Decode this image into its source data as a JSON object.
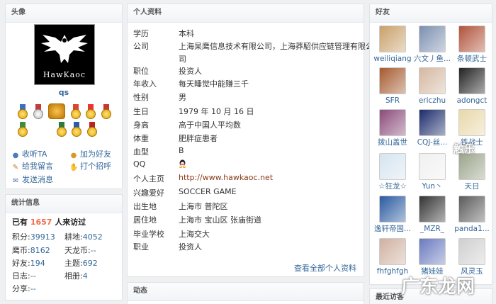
{
  "avatar_panel": {
    "header": "头像",
    "logo_text": "HawKaoc",
    "username": "qs",
    "actions": {
      "add_friend_ta": "收听TA",
      "add_friend": "加为好友",
      "leave_message": "给我留言",
      "greet": "打个招呼",
      "send_message": "发送消息"
    }
  },
  "stats_panel": {
    "header": "统计信息",
    "visit_prefix": "已有",
    "visit_count": "1657",
    "visit_suffix": "人来访过",
    "items": [
      {
        "label": "积分:",
        "value": "39913"
      },
      {
        "label": "耕地:",
        "value": "4052"
      },
      {
        "label": "鹰币:",
        "value": "8162"
      },
      {
        "label": "天龙币:",
        "value": "--"
      },
      {
        "label": "好友:",
        "value": "194"
      },
      {
        "label": "主题:",
        "value": "692"
      },
      {
        "label": "日志:",
        "value": "--"
      },
      {
        "label": "相册:",
        "value": "4"
      },
      {
        "label": "分享:",
        "value": "--"
      }
    ]
  },
  "profile_panel": {
    "header": "个人资料",
    "fields": [
      {
        "label": "学历",
        "value": "本科"
      },
      {
        "label": "公司",
        "value": "上海杲鹰信息技术有限公司，上海莽駋供应链管理有限公"
      },
      {
        "label": "",
        "value": "司"
      },
      {
        "label": "职位",
        "value": "投资人"
      },
      {
        "label": "年收入",
        "value": "每天睡觉中能赚三千"
      },
      {
        "label": "性别",
        "value": "男"
      },
      {
        "label": "生日",
        "value": "1979 年 10 月 16 日"
      },
      {
        "label": "身高",
        "value": "高于中国人平均数"
      },
      {
        "label": "体重",
        "value": "肥胖症患者"
      },
      {
        "label": "血型",
        "value": "B"
      },
      {
        "label": "QQ",
        "value": ""
      },
      {
        "label": "个人主页",
        "value": "http://www.hawkaoc.net"
      },
      {
        "label": "兴趣爱好",
        "value": "SOCCER GAME"
      },
      {
        "label": "出生地",
        "value": "上海市 普陀区"
      },
      {
        "label": "居住地",
        "value": "上海市 宝山区 张庙街道"
      },
      {
        "label": "毕业学校",
        "value": "上海交大"
      },
      {
        "label": "职业",
        "value": "投资人"
      }
    ],
    "more_link": "查看全部个人资料"
  },
  "feed_panel": {
    "header": "动态"
  },
  "friends_panel": {
    "header": "好友",
    "friends": [
      {
        "name": "weiliqiang",
        "color": "#c9a06a"
      },
      {
        "name": "六文丿鱼...",
        "color": "#7c8fb0"
      },
      {
        "name": "条顿武士",
        "color": "#b0533a"
      },
      {
        "name": "SFR",
        "color": "#a55a2e"
      },
      {
        "name": "ericzhu",
        "color": "#d4b8a0"
      },
      {
        "name": "adongct",
        "color": "#222222"
      },
      {
        "name": "拨山盖世",
        "color": "#8a4a7a"
      },
      {
        "name": "CQJ-丝...",
        "color": "#1b2b6b"
      },
      {
        "name": "铁战士",
        "color": "#e8d7a8"
      },
      {
        "name": "☆狂龙☆",
        "color": "#d6e4ef"
      },
      {
        "name": "Yun丶",
        "color": "#f0f0f0"
      },
      {
        "name": "天日",
        "color": "#9aa48a"
      },
      {
        "name": "逸轩帝国...",
        "color": "#2a5aa0"
      },
      {
        "name": "_MZR_",
        "color": "#333333"
      },
      {
        "name": "panda1...",
        "color": "#5a5a5a"
      },
      {
        "name": "fhfghfgh",
        "color": "#d0b0a0"
      },
      {
        "name": "猪娃娃",
        "color": "#6a7abf"
      },
      {
        "name": "风灵玉",
        "color": "#cfcfcf"
      }
    ]
  },
  "visitors_panel": {
    "header": "最近访客"
  },
  "watermarks": {
    "small": "触乐",
    "large": "广东龙网"
  },
  "colors": {
    "link": "#336699",
    "visit_count": "#f26c4f",
    "homepage": "#8b3a1a"
  }
}
